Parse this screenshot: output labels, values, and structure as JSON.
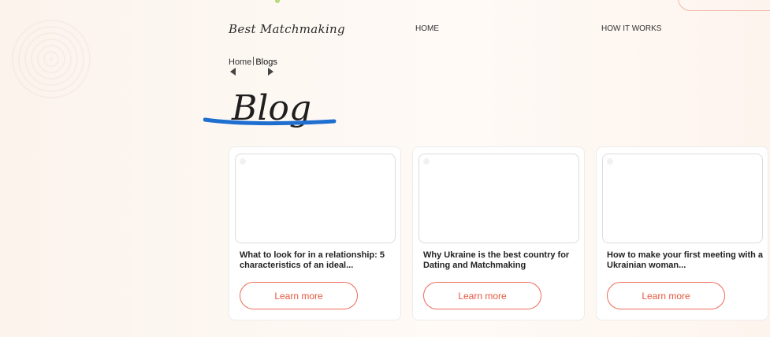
{
  "site": {
    "logo": "Best Matchmaking"
  },
  "nav": {
    "home": "HOME",
    "how_it_works": "HOW IT WORKS"
  },
  "breadcrumb": {
    "home": "Home",
    "current": "Blogs"
  },
  "page": {
    "title": "Blog"
  },
  "colors": {
    "accent": "#e4583f",
    "strike": "#1e6fd0"
  },
  "cards": [
    {
      "title": "What to look for in a relationship: 5 characteristics of an ideal...",
      "button": "Learn more"
    },
    {
      "title": "Why Ukraine is the best country for Dating and Matchmaking",
      "button": "Learn more"
    },
    {
      "title": "How to make your first meeting with a Ukrainian woman...",
      "button": "Learn more"
    }
  ]
}
